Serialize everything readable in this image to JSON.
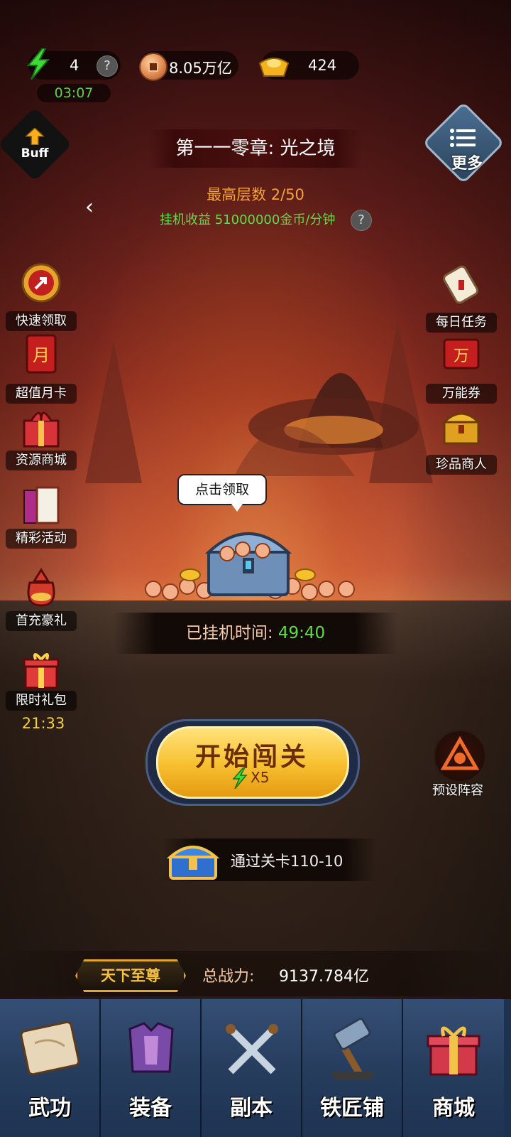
{
  "resources": {
    "energy": "4",
    "energy_timer": "03:07",
    "help": "?",
    "coins": "8.05万亿",
    "gold": "424"
  },
  "top": {
    "buff_label": "Buff",
    "more_label": "更多"
  },
  "chapter": {
    "title": "第一一零章: 光之境",
    "floor": "最高层数 2/50",
    "income": "挂机收益 51000000金币/分钟"
  },
  "left_menu": [
    {
      "label": "快速领取"
    },
    {
      "label": "超值月卡"
    },
    {
      "label": "资源商城"
    },
    {
      "label": "精彩活动"
    },
    {
      "label": "首充豪礼"
    },
    {
      "label": "限时礼包"
    }
  ],
  "limited_timer": "21:33",
  "right_menu": [
    {
      "label": "每日任务"
    },
    {
      "label": "万能券"
    },
    {
      "label": "珍品商人"
    }
  ],
  "idle": {
    "bubble": "点击领取",
    "label": "已挂机时间:",
    "time": "49:40"
  },
  "start": {
    "title": "开始闯关",
    "cost": "X5"
  },
  "formation_label": "预设阵容",
  "pass_reward": "通过关卡110-10",
  "power": {
    "badge": "天下至尊",
    "label": "总战力:",
    "value": "9137.784亿"
  },
  "nav": [
    {
      "label": "武功"
    },
    {
      "label": "装备"
    },
    {
      "label": "副本"
    },
    {
      "label": "铁匠铺"
    },
    {
      "label": "商城"
    }
  ],
  "colors": {
    "accent_green": "#5fdc4a",
    "accent_orange": "#f6a23a",
    "button_gold": "#f7bf2f",
    "nav_blue": "#263d5e"
  }
}
